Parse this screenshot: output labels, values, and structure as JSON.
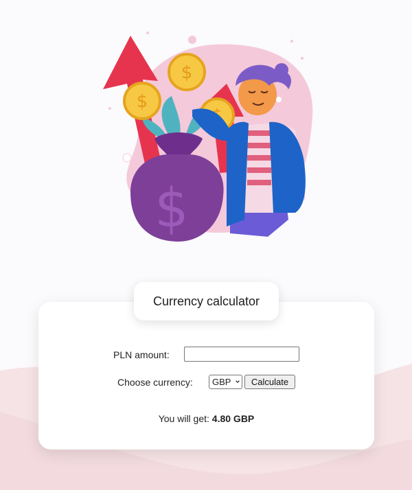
{
  "card": {
    "title": "Currency calculator",
    "amount_label": "PLN amount:",
    "amount_value": "",
    "currency_label": "Choose currency:",
    "currency_selected": "GBP",
    "calculate_label": "Calculate",
    "result_prefix": "You will get:",
    "result_value": "4.80 GBP"
  },
  "colors": {
    "background": "#fbfafc",
    "accent_pink": "#f4c9da",
    "arrow_red": "#e6344f",
    "coin_gold": "#f7c843",
    "bag_purple": "#7d3f98",
    "jacket_blue": "#1e63c8"
  },
  "icons": {
    "chevron": "chevron-down-icon",
    "illustration": "money-bag-illustration"
  }
}
